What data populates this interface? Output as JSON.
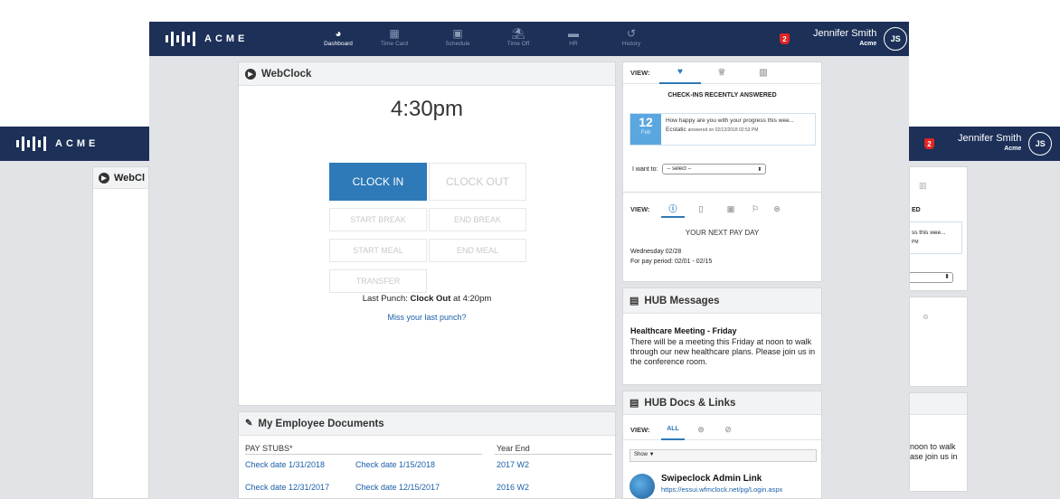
{
  "brand": {
    "name": "ACME"
  },
  "user": {
    "name": "Jennifer Smith",
    "company": "Acme",
    "initials": "JS",
    "notifications": "2"
  },
  "nav": [
    {
      "label": "Dashboard",
      "icon": "dashboard-icon",
      "glyph": "◕"
    },
    {
      "label": "Time Card",
      "icon": "timecard-icon",
      "glyph": "▦"
    },
    {
      "label": "Schedule",
      "icon": "calendar-icon",
      "glyph": "▣"
    },
    {
      "label": "Time Off",
      "icon": "beach-icon",
      "glyph": "⛱"
    },
    {
      "label": "HR",
      "icon": "folder-icon",
      "glyph": "▬"
    },
    {
      "label": "History",
      "icon": "history-icon",
      "glyph": "↺"
    }
  ],
  "webclock": {
    "title": "WebClock",
    "time": "4:30pm",
    "clock_in": "CLOCK IN",
    "clock_out": "CLOCK OUT",
    "start_break": "START BREAK",
    "end_break": "END BREAK",
    "start_meal": "START MEAL",
    "end_meal": "END MEAL",
    "transfer": "TRANSFER",
    "last_punch_prefix": "Last Punch:",
    "last_punch_type": "Clock Out",
    "last_punch_suffix": "at 4:20pm",
    "miss_link": "Miss your last punch?"
  },
  "checkins": {
    "view_label": "VIEW:",
    "heading": "CHECK-INS RECENTLY ANSWERED",
    "day": "12",
    "month": "Feb",
    "question": "How happy are you with your progress this wee...",
    "answer": "Ecstatic",
    "answered_on": "answered on 02/12/2018 02:53 PM",
    "i_want_label": "I want to:",
    "select_value": "-- select --"
  },
  "payday": {
    "view_label": "VIEW:",
    "heading": "YOUR NEXT PAY DAY",
    "date": "Wednesday 02/28",
    "period": "For pay period: 02/01 - 02/15"
  },
  "hub_messages": {
    "title": "HUB Messages",
    "msg_title": "Healthcare Meeting - Friday",
    "msg_body": "There will be a meeting this Friday at noon to walk through our new healthcare plans. Please join us in the conference room."
  },
  "hub_docs": {
    "title": "HUB Docs & Links",
    "view_label": "VIEW:",
    "tab_all": "ALL",
    "show_label": "Show ▼",
    "link_title": "Swipeclock Admin Link",
    "link_url": "https://essui.wfmclock.net/pg/Login.aspx"
  },
  "documents": {
    "title": "My Employee Documents",
    "pay_stubs_label": "PAY STUBS*",
    "year_end_label": "Year End",
    "rows": [
      [
        "Check date 1/31/2018",
        "Check date 1/15/2018",
        "2017 W2"
      ],
      [
        "Check date 12/31/2017",
        "Check date 12/15/2017",
        "2016 W2"
      ]
    ]
  },
  "background": {
    "webclock_title": "WebCl",
    "snippet1": "ED",
    "snippet2": "ss this wee...",
    "snippet3": "PM",
    "snippet4": "noon to walk",
    "snippet5": "ase join us in"
  }
}
